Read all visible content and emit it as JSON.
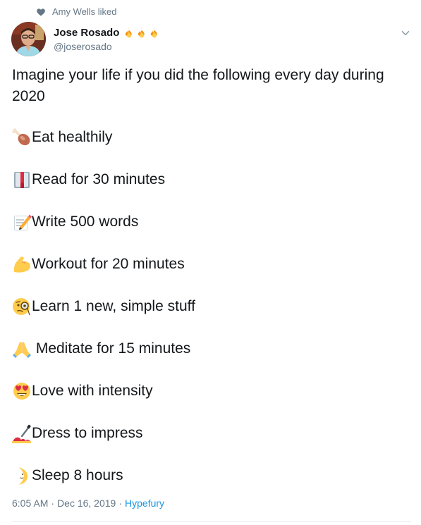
{
  "social_context": {
    "text": "Amy Wells liked",
    "icon": "heart-icon"
  },
  "author": {
    "display_name": "Jose Rosado",
    "name_emojis": [
      "fire-icon",
      "fire-icon",
      "fire-icon"
    ],
    "handle": "@joserosado",
    "avatar": "avatar"
  },
  "tweet": {
    "intro": "Imagine your life if you did the following every day during 2020",
    "items": [
      {
        "emoji": "poultry-leg-icon",
        "text": "Eat healthily"
      },
      {
        "emoji": "book-icon",
        "text": "Read for 30 minutes"
      },
      {
        "emoji": "memo-icon",
        "text": "Write 500 words"
      },
      {
        "emoji": "flexed-biceps-icon",
        "text": "Workout for 20 minutes"
      },
      {
        "emoji": "monocle-face-icon",
        "text": "Learn 1 new, simple stuff"
      },
      {
        "emoji": "folded-hands-icon",
        "text": " Meditate for 15 minutes"
      },
      {
        "emoji": "heart-eyes-icon",
        "text": "Love with intensity"
      },
      {
        "emoji": "nail-polish-icon",
        "text": "Dress to impress"
      },
      {
        "emoji": "crescent-moon-icon",
        "text": "Sleep 8 hours"
      }
    ]
  },
  "meta": {
    "timestamp": "6:05 AM",
    "separator": "·",
    "date": "Dec 16, 2019",
    "source": "Hypefury"
  },
  "colors": {
    "text": "#14171a",
    "secondary": "#657786",
    "link": "#1b95e0",
    "divider": "#e6ecf0"
  }
}
